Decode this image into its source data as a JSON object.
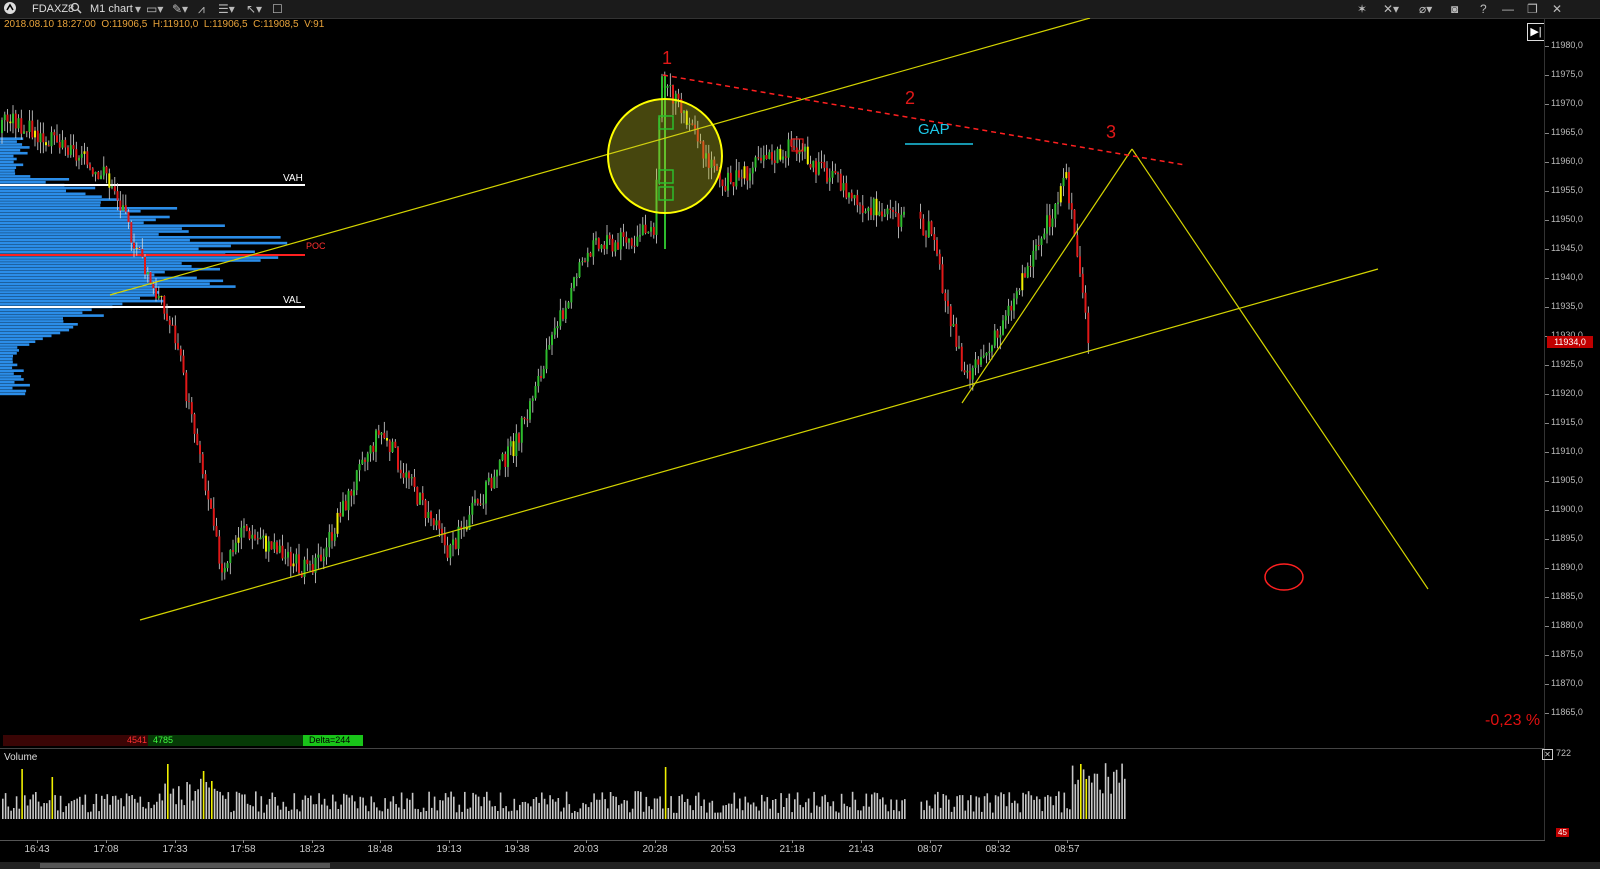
{
  "toolbar": {
    "symbol": "FDAXZ8",
    "chart_type": "M1 chart",
    "icons": [
      "app-logo-icon",
      "search-icon",
      "monitor-icon",
      "pen-icon",
      "indicator-icon",
      "bars-icon",
      "cursor-icon",
      "window-icon",
      "magic-icon",
      "crosshair-icon",
      "link-icon",
      "camera-icon",
      "help-icon",
      "minimize-icon",
      "maximize-icon",
      "close-icon"
    ]
  },
  "info": {
    "datetime": "2018.08.10 18:27:00",
    "open": "O:11906,5",
    "high": "H:11910,0",
    "low": "L:11906,5",
    "close": "C:11908,5",
    "volume": "V:91"
  },
  "price_axis": {
    "labels": [
      "11980,0",
      "11975,0",
      "11970,0",
      "11965,0",
      "11960,0",
      "11955,0",
      "11950,0",
      "11945,0",
      "11940,0",
      "11935,0",
      "11930,0",
      "11925,0",
      "11920,0",
      "11915,0",
      "11910,0",
      "11905,0",
      "11900,0",
      "11895,0",
      "11890,0",
      "11885,0",
      "11880,0",
      "11875,0",
      "11870,0",
      "11865,0"
    ],
    "last_price": "11934,0"
  },
  "time_axis": {
    "labels": [
      "16:43",
      "17:08",
      "17:33",
      "17:58",
      "18:23",
      "18:48",
      "19:13",
      "19:38",
      "20:03",
      "20:28",
      "20:53",
      "21:18",
      "21:43",
      "08:07",
      "08:32",
      "08:57"
    ]
  },
  "annotations": {
    "point1": "1",
    "point2": "2",
    "point3": "3",
    "gap": "GAP",
    "vah": "VAH",
    "poc": "POC",
    "val": "VAL",
    "percent": "-0,23 %"
  },
  "delta_bar": {
    "sell": "4541",
    "buy": "4785",
    "delta": "Delta=244"
  },
  "volume_panel": {
    "label": "Volume",
    "max_label": "722",
    "current": "45"
  },
  "colors": {
    "background": "#000000",
    "bull": "#2dbb2d",
    "bear": "#e01818",
    "trendline": "#d4d400",
    "profile": "#2b8de8",
    "poc": "#ff2020",
    "gap": "#1ec8e8",
    "annotation": "#e01818"
  },
  "chart_data": {
    "type": "candlestick",
    "timeframe": "M1",
    "instrument": "FDAXZ8",
    "ylim": [
      11862,
      11984
    ],
    "value_area": {
      "vah": 11955.5,
      "poc": 11944,
      "val": 11935
    },
    "last_price": 11934,
    "change_percent": -0.23,
    "approx_close_path": [
      {
        "t": "16:43",
        "p": 11965
      },
      {
        "t": "17:08",
        "p": 11958
      },
      {
        "t": "17:33",
        "p": 11930
      },
      {
        "t": "17:50",
        "p": 11890
      },
      {
        "t": "17:58",
        "p": 11897
      },
      {
        "t": "18:23",
        "p": 11889
      },
      {
        "t": "18:48",
        "p": 11914
      },
      {
        "t": "19:13",
        "p": 11893
      },
      {
        "t": "19:38",
        "p": 11912
      },
      {
        "t": "20:03",
        "p": 11945
      },
      {
        "t": "20:28",
        "p": 11948
      },
      {
        "t": "20:30",
        "p": 11975
      },
      {
        "t": "20:53",
        "p": 11956
      },
      {
        "t": "21:18",
        "p": 11963
      },
      {
        "t": "21:43",
        "p": 11953
      },
      {
        "t": "08:07",
        "p": 11948
      },
      {
        "t": "08:20",
        "p": 11922
      },
      {
        "t": "08:32",
        "p": 11930
      },
      {
        "t": "08:57",
        "p": 11957
      },
      {
        "t": "09:05",
        "p": 11929
      }
    ]
  }
}
